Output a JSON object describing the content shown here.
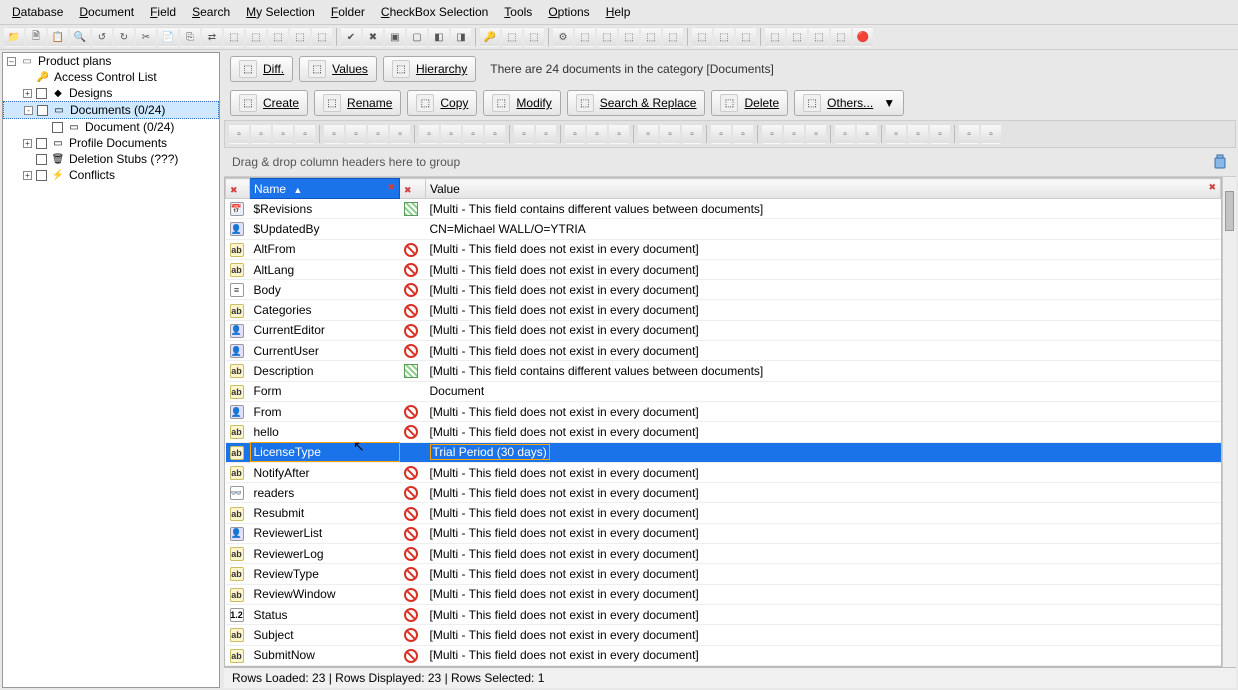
{
  "menu": [
    "Database",
    "Document",
    "Field",
    "Search",
    "My Selection",
    "Folder",
    "CheckBox Selection",
    "Tools",
    "Options",
    "Help"
  ],
  "tree": {
    "root": "Product plans",
    "items": [
      {
        "label": "Access Control List",
        "icon": "key",
        "indent": 1
      },
      {
        "label": "Designs",
        "icon": "design",
        "indent": 1,
        "chk": true,
        "exp": "+"
      },
      {
        "label": "Documents  (0/24)",
        "icon": "docs",
        "indent": 1,
        "chk": true,
        "exp": "-",
        "selected": true
      },
      {
        "label": "Document  (0/24)",
        "icon": "doc",
        "indent": 2,
        "chk": true
      },
      {
        "label": "Profile Documents",
        "icon": "profile",
        "indent": 1,
        "chk": true,
        "exp": "+"
      },
      {
        "label": "Deletion Stubs   (???)",
        "icon": "trash",
        "indent": 1,
        "chk": true
      },
      {
        "label": "Conflicts",
        "icon": "conflict",
        "indent": 1,
        "chk": true,
        "exp": "+"
      }
    ]
  },
  "topbuttons": {
    "row1": [
      {
        "label": "Diff.",
        "icon": "diff"
      },
      {
        "label": "Values",
        "icon": "values"
      },
      {
        "label": "Hierarchy",
        "icon": "hierarchy"
      }
    ],
    "info": "There are 24 documents in the category [Documents]",
    "row2": [
      {
        "label": "Create",
        "icon": "create"
      },
      {
        "label": "Rename",
        "icon": "rename"
      },
      {
        "label": "Copy",
        "icon": "copy"
      },
      {
        "label": "Modify",
        "icon": "modify"
      },
      {
        "label": "Search & Replace",
        "icon": "search-replace"
      },
      {
        "label": "Delete",
        "icon": "delete"
      },
      {
        "label": "Others...",
        "icon": "others",
        "dropdown": true
      }
    ]
  },
  "group_hint": "Drag & drop column headers here to group",
  "columns": {
    "name": "Name",
    "value": "Value"
  },
  "rows": [
    {
      "name": "$Revisions",
      "type": "date",
      "vicon": "grid",
      "value": "[Multi - This field contains different values between documents]"
    },
    {
      "name": "$UpdatedBy",
      "type": "person",
      "vicon": "",
      "value": "CN=Michael WALL/O=YTRIA"
    },
    {
      "name": "AltFrom",
      "type": "ab",
      "vicon": "no",
      "value": "[Multi - This field does not exist in every document]"
    },
    {
      "name": "AltLang",
      "type": "ab",
      "vicon": "no",
      "value": "[Multi - This field does not exist in every document]"
    },
    {
      "name": "Body",
      "type": "body",
      "vicon": "no",
      "value": "[Multi - This field does not exist in every document]"
    },
    {
      "name": "Categories",
      "type": "ab",
      "vicon": "no",
      "value": "[Multi - This field does not exist in every document]"
    },
    {
      "name": "CurrentEditor",
      "type": "person",
      "vicon": "no",
      "value": "[Multi - This field does not exist in every document]"
    },
    {
      "name": "CurrentUser",
      "type": "person",
      "vicon": "no",
      "value": "[Multi - This field does not exist in every document]"
    },
    {
      "name": "Description",
      "type": "ab",
      "vicon": "grid",
      "value": "[Multi - This field contains different values between documents]"
    },
    {
      "name": "Form",
      "type": "ab",
      "vicon": "",
      "value": "Document"
    },
    {
      "name": "From",
      "type": "person",
      "vicon": "no",
      "value": "[Multi - This field does not exist in every document]"
    },
    {
      "name": "hello",
      "type": "ab",
      "vicon": "no",
      "value": "[Multi - This field does not exist in every document]"
    },
    {
      "name": "LicenseType",
      "type": "ab",
      "vicon": "",
      "value": "Trial Period (30 days)",
      "selected": true
    },
    {
      "name": "NotifyAfter",
      "type": "ab",
      "vicon": "no",
      "value": "[Multi - This field does not exist in every document]"
    },
    {
      "name": "readers",
      "type": "readers",
      "vicon": "no",
      "value": "[Multi - This field does not exist in every document]"
    },
    {
      "name": "Resubmit",
      "type": "ab",
      "vicon": "no",
      "value": "[Multi - This field does not exist in every document]"
    },
    {
      "name": "ReviewerList",
      "type": "person",
      "vicon": "no",
      "value": "[Multi - This field does not exist in every document]"
    },
    {
      "name": "ReviewerLog",
      "type": "ab",
      "vicon": "no",
      "value": "[Multi - This field does not exist in every document]"
    },
    {
      "name": "ReviewType",
      "type": "ab",
      "vicon": "no",
      "value": "[Multi - This field does not exist in every document]"
    },
    {
      "name": "ReviewWindow",
      "type": "ab",
      "vicon": "no",
      "value": "[Multi - This field does not exist in every document]"
    },
    {
      "name": "Status",
      "type": "num",
      "vicon": "no",
      "value": "[Multi - This field does not exist in every document]"
    },
    {
      "name": "Subject",
      "type": "ab",
      "vicon": "no",
      "value": "[Multi - This field does not exist in every document]"
    },
    {
      "name": "SubmitNow",
      "type": "ab",
      "vicon": "no",
      "value": "[Multi - This field does not exist in every document]"
    }
  ],
  "status": "Rows Loaded: 23  |  Rows Displayed: 23  |  Rows Selected: 1"
}
